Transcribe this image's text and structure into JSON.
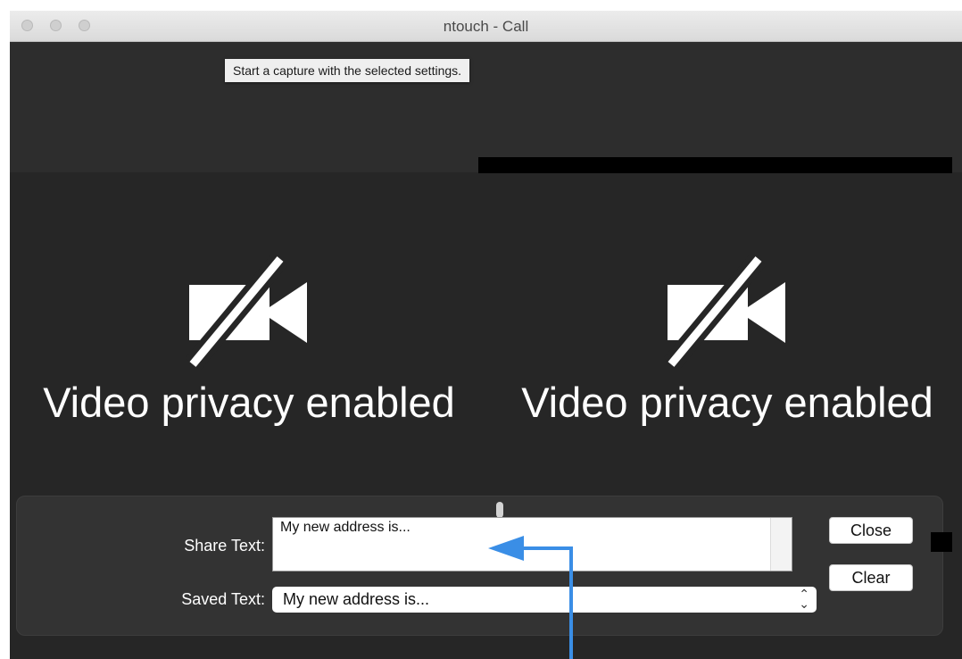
{
  "window": {
    "title": "ntouch - Call"
  },
  "tooltip": {
    "text": "Start a capture with the selected settings."
  },
  "video": {
    "left": {
      "status": "Video privacy enabled",
      "icon": "video-off-icon"
    },
    "right": {
      "status": "Video privacy enabled",
      "icon": "video-off-icon"
    }
  },
  "share_panel": {
    "share_label": "Share Text:",
    "share_value": "My new address is...",
    "saved_label": "Saved Text:",
    "saved_value": "My new address is...",
    "close_label": "Close",
    "clear_label": "Clear"
  },
  "colors": {
    "annotation_arrow": "#3a8ee6",
    "background": "#262626"
  }
}
